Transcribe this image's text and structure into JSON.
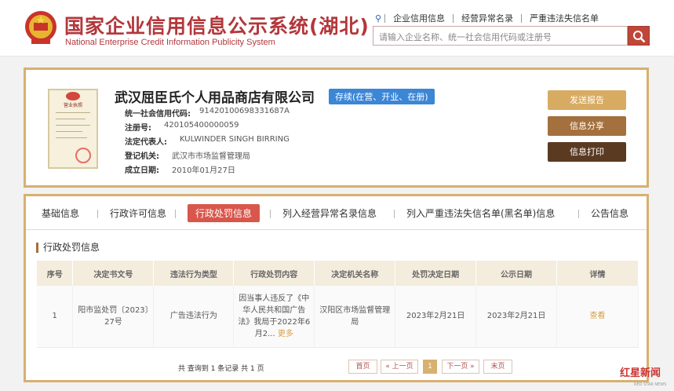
{
  "header": {
    "title": "国家企业信用信息公示系统(湖北)",
    "subtitle": "National Enterprise Credit Information Publicity System",
    "search_tabs": [
      "企业信用信息",
      "经营异常名录",
      "严重违法失信名单"
    ],
    "search_placeholder": "请输入企业名称、统一社会信用代码或注册号",
    "accent": "#b3373b"
  },
  "company": {
    "name": "武汉屈臣氏个人用品商店有限公司",
    "status": "存续(在营、开业、在册)",
    "license_title": "营业执照",
    "fields": [
      {
        "label": "统一社会信用代码:",
        "value": "91420100698331687A"
      },
      {
        "label": "注册号:",
        "value": "420105400000059"
      },
      {
        "label": "法定代表人:",
        "value": "KULWINDER SINGH BIRRING"
      },
      {
        "label": "登记机关:",
        "value": "武汉市市场监督管理局"
      },
      {
        "label": "成立日期:",
        "value": "2010年01月27日"
      }
    ],
    "actions": {
      "report": "发送报告",
      "share": "信息分享",
      "print": "信息打印"
    }
  },
  "tabs": [
    "基础信息",
    "行政许可信息",
    "行政处罚信息",
    "列入经营异常名录信息",
    "列入严重违法失信名单(黑名单)信息",
    "公告信息"
  ],
  "active_tab": "行政处罚信息",
  "section_title": "行政处罚信息",
  "table": {
    "headers": [
      "序号",
      "决定书文号",
      "违法行为类型",
      "行政处罚内容",
      "决定机关名称",
      "处罚决定日期",
      "公示日期",
      "详情"
    ],
    "rows": [
      {
        "index": "1",
        "doc_no": "阳市监处罚〔2023〕27号",
        "type": "广告违法行为",
        "content": "因当事人违反了《中华人民共和国广告法》我局于2022年6月2...",
        "more": "更多",
        "authority": "汉阳区市场监督管理局",
        "decision_date": "2023年2月21日",
        "publish_date": "2023年2月21日",
        "detail": "查看"
      }
    ]
  },
  "pagination": {
    "summary": "共 查询到 1 条记录 共 1 页",
    "first": "首页",
    "prev": "« 上一页",
    "current": "1",
    "next": "下一页 »",
    "last": "末页"
  },
  "watermark": {
    "text": "红星新闻",
    "sub": "RED STAR NEWS"
  }
}
